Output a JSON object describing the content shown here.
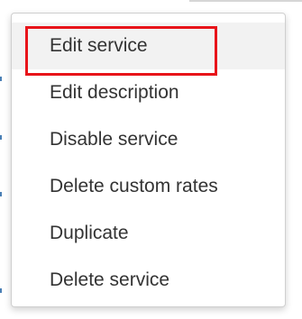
{
  "menu": {
    "items": [
      {
        "label": "Edit service"
      },
      {
        "label": "Edit description"
      },
      {
        "label": "Disable service"
      },
      {
        "label": "Delete custom rates"
      },
      {
        "label": "Duplicate"
      },
      {
        "label": "Delete service"
      }
    ]
  },
  "colors": {
    "highlight_border": "#e8141a",
    "hover_background": "#f2f2f2",
    "text": "#333333"
  }
}
